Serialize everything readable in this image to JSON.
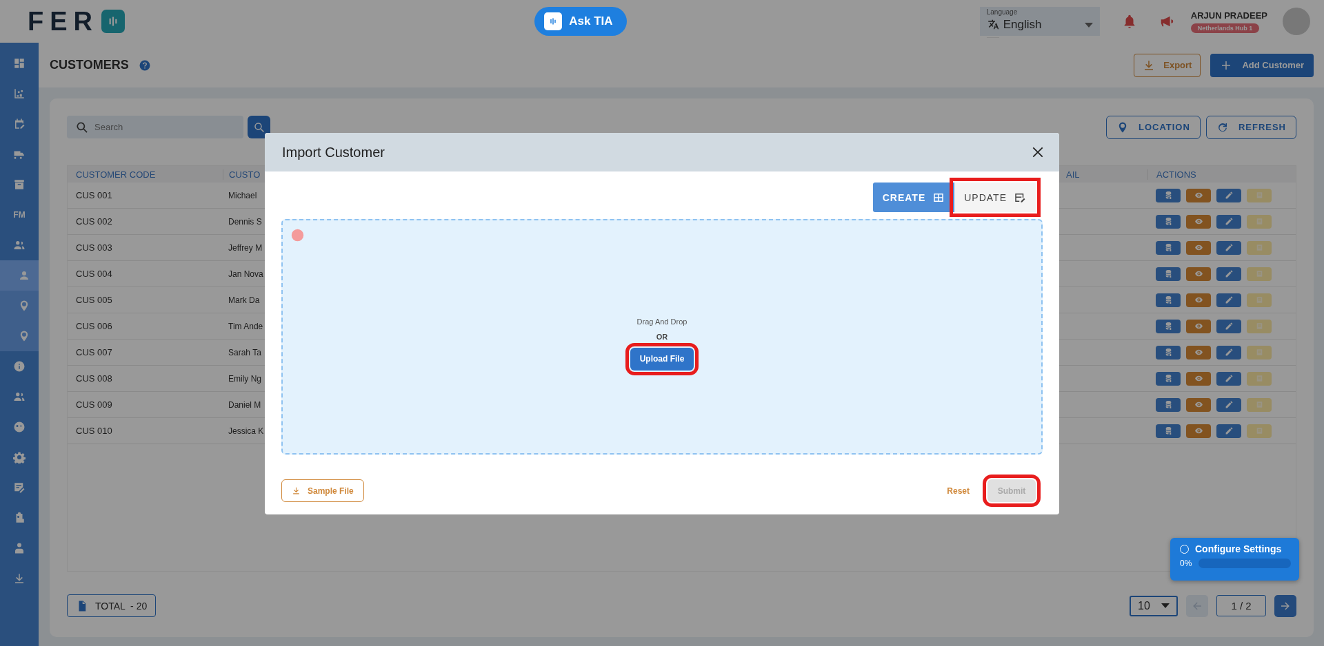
{
  "logo": {
    "text": "FER"
  },
  "ask_button": {
    "label": "Ask TIA"
  },
  "language": {
    "label": "Language",
    "value": "English"
  },
  "user": {
    "name": "ARJUN PRADEEP",
    "hub": "Netherlands Hub 1"
  },
  "sidebar": {
    "items": [
      {
        "selected": false
      },
      {
        "selected": false
      },
      {
        "selected": false
      },
      {
        "selected": false
      },
      {
        "selected": false
      },
      {
        "label": "FM",
        "selected": false
      },
      {
        "selected": false,
        "expanded": true,
        "children": [
          {
            "selected": true
          },
          {
            "selected": false
          },
          {
            "selected": false
          }
        ]
      },
      {
        "selected": false
      },
      {
        "selected": false
      },
      {
        "selected": false
      },
      {
        "selected": false
      },
      {
        "selected": false
      },
      {
        "selected": false
      },
      {
        "selected": false
      },
      {
        "selected": false
      }
    ]
  },
  "page": {
    "title": "CUSTOMERS",
    "export": "Export",
    "add": "Add Customer"
  },
  "toolbar": {
    "search_placeholder": "Search",
    "location": "LOCATION",
    "refresh": "REFRESH"
  },
  "table": {
    "columns": [
      "CUSTOMER CODE",
      "CUSTO",
      "AIL",
      "ACTIONS"
    ],
    "rows": [
      {
        "code": "CUS 001",
        "name": "Michael"
      },
      {
        "code": "CUS 002",
        "name": "Dennis S"
      },
      {
        "code": "CUS 003",
        "name": "Jeffrey M"
      },
      {
        "code": "CUS 004",
        "name": "Jan Nova"
      },
      {
        "code": "CUS 005",
        "name": "Mark Da"
      },
      {
        "code": "CUS 006",
        "name": "Tim Ande"
      },
      {
        "code": "CUS 007",
        "name": "Sarah Ta"
      },
      {
        "code": "CUS 008",
        "name": "Emily Ng"
      },
      {
        "code": "CUS 009",
        "name": "Daniel M"
      },
      {
        "code": "CUS 010",
        "name": "Jessica K"
      }
    ]
  },
  "footer": {
    "total": "TOTAL  - 20",
    "page_size": "10",
    "page": "1 / 2"
  },
  "modal": {
    "title": "Import Customer",
    "modes": [
      {
        "label": "CREATE",
        "selected": true,
        "highlighted": false
      },
      {
        "label": "UPDATE",
        "selected": false,
        "highlighted": true
      }
    ],
    "drop_text": "Drag And Drop",
    "or_text": "OR",
    "upload": {
      "label": "Upload File",
      "highlighted": true
    },
    "sample": "Sample File",
    "reset": "Reset",
    "submit": {
      "label": "Submit",
      "disabled": true,
      "highlighted": true
    }
  },
  "configure": {
    "title": "Configure Settings",
    "percent": "0%",
    "level": 0
  }
}
